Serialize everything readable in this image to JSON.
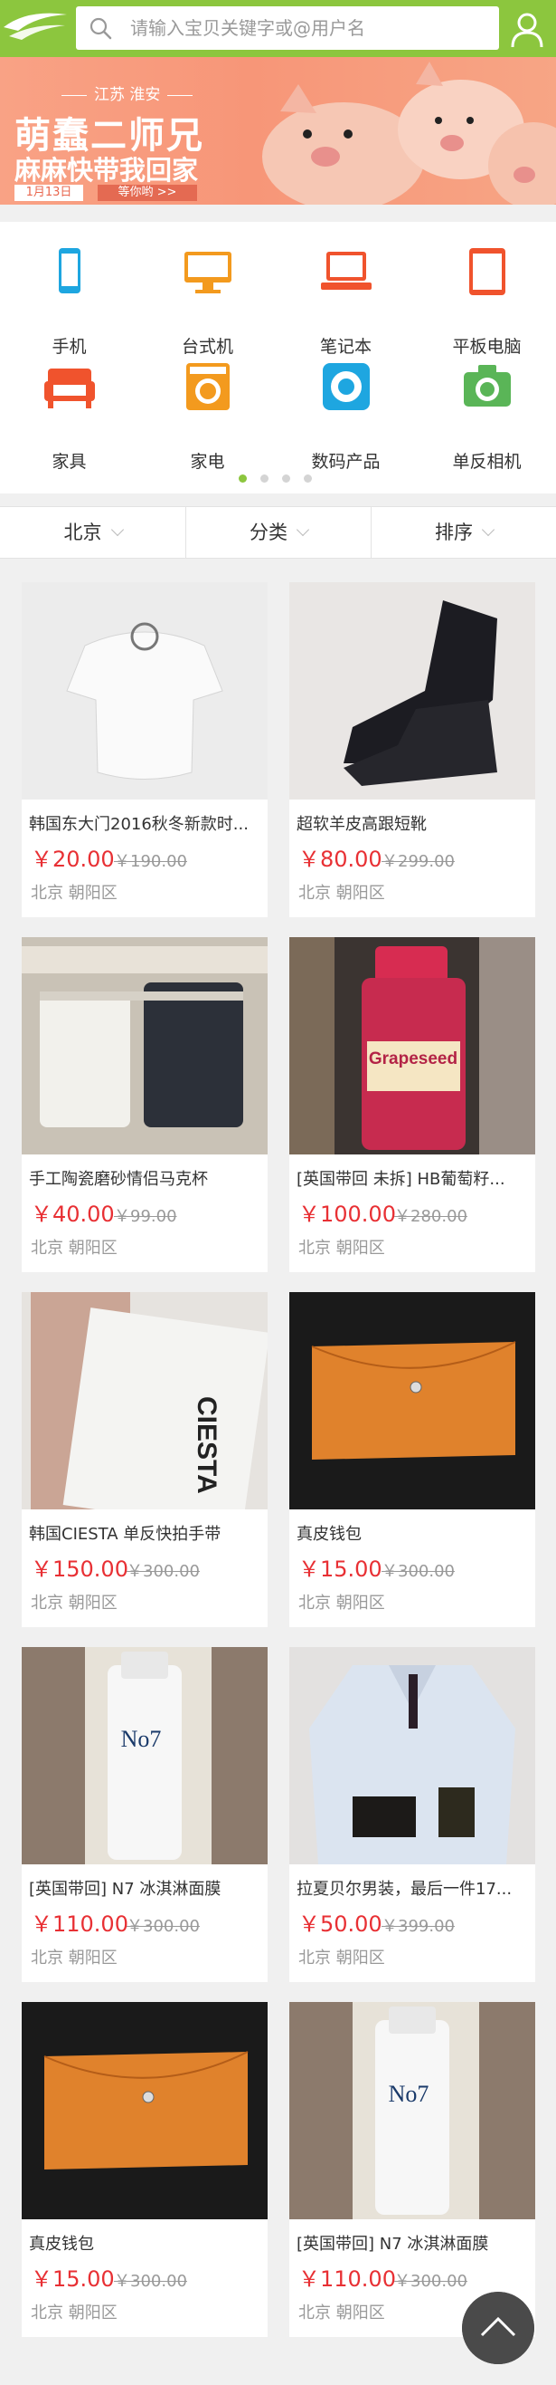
{
  "header": {
    "search_placeholder": "请输入宝贝关键字或@用户名",
    "logo_icon": "app-logo-icon",
    "user_icon": "user-icon",
    "brand_color": "#8cc63e"
  },
  "banner": {
    "location": "江苏 淮安",
    "title1": "萌蠢二师兄",
    "title2": "麻麻快带我回家",
    "date": "1月13日",
    "cta": "等你哟 >>",
    "slide_count": 4,
    "active_slide": 2
  },
  "categories": [
    {
      "label": "手机",
      "icon": "phone-icon",
      "color": "#1ea6e0"
    },
    {
      "label": "台式机",
      "icon": "desktop-icon",
      "color": "#f39a1e"
    },
    {
      "label": "笔记本",
      "icon": "laptop-icon",
      "color": "#f0532d"
    },
    {
      "label": "平板电脑",
      "icon": "tablet-icon",
      "color": "#f0532d"
    },
    {
      "label": "家具",
      "icon": "sofa-icon",
      "color": "#f0532d"
    },
    {
      "label": "家电",
      "icon": "washing-machine-icon",
      "color": "#f39a1e"
    },
    {
      "label": "数码产品",
      "icon": "music-player-icon",
      "color": "#1ea6e0"
    },
    {
      "label": "单反相机",
      "icon": "camera-icon",
      "color": "#5ab557"
    }
  ],
  "category_pages": {
    "count": 4,
    "active": 1
  },
  "filters": [
    {
      "label": "北京"
    },
    {
      "label": "分类"
    },
    {
      "label": "排序"
    }
  ],
  "products": [
    {
      "name": "韩国东大门2016秋冬新款时...",
      "price": "￥20.00",
      "old_price": "￥190.00",
      "location": "北京 朝阳区"
    },
    {
      "name": "超软羊皮高跟短靴",
      "price": "￥80.00",
      "old_price": "￥299.00",
      "location": "北京 朝阳区"
    },
    {
      "name": "手工陶瓷磨砂情侣马克杯",
      "price": "￥40.00",
      "old_price": "￥99.00",
      "location": "北京 朝阳区"
    },
    {
      "name": "[英国带回 未拆] HB葡萄籽...",
      "price": "￥100.00",
      "old_price": "￥280.00",
      "location": "北京 朝阳区",
      "image_text": "Grapeseed"
    },
    {
      "name": "韩国CIESTA 单反快拍手带",
      "price": "￥150.00",
      "old_price": "￥300.00",
      "location": "北京 朝阳区",
      "image_text": "CIESTA"
    },
    {
      "name": "真皮钱包",
      "price": "￥15.00",
      "old_price": "￥300.00",
      "location": "北京 朝阳区"
    },
    {
      "name": "[英国带回] N7 冰淇淋面膜",
      "price": "￥110.00",
      "old_price": "￥300.00",
      "location": "北京 朝阳区",
      "image_text": "No7"
    },
    {
      "name": "拉夏贝尔男装，最后一件17...",
      "price": "￥50.00",
      "old_price": "￥399.00",
      "location": "北京 朝阳区"
    },
    {
      "name": "真皮钱包",
      "price": "￥15.00",
      "old_price": "￥300.00",
      "location": "北京 朝阳区"
    },
    {
      "name": "[英国带回] N7 冰淇淋面膜",
      "price": "￥110.00",
      "old_price": "￥300.00",
      "location": "北京 朝阳区",
      "image_text": "No7"
    }
  ],
  "back_to_top_icon": "arrow-up-icon"
}
